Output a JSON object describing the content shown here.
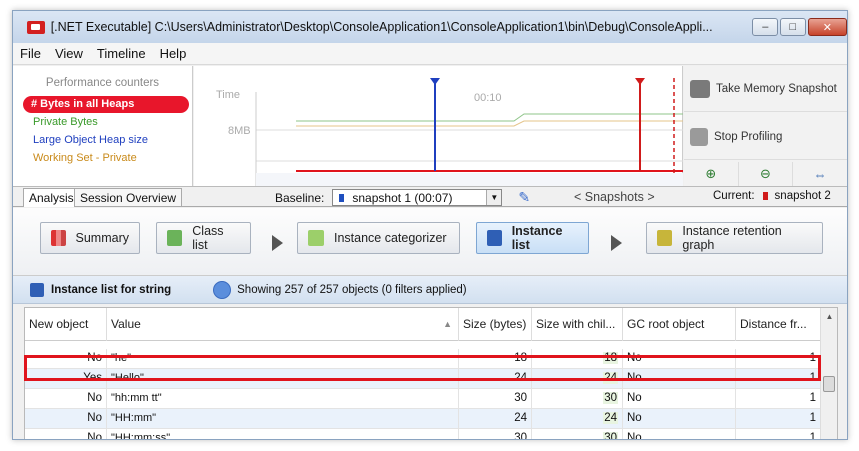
{
  "window": {
    "title": "[.NET Executable] C:\\Users\\Administrator\\Desktop\\ConsoleApplication1\\ConsoleApplication1\\bin\\Debug\\ConsoleAppli...",
    "minimize": "–",
    "maximize": "□",
    "close": "✕"
  },
  "menu": [
    "File",
    "View",
    "Timeline",
    "Help"
  ],
  "counters": {
    "title": "Performance counters",
    "items": [
      {
        "label": "# Bytes in all Heaps",
        "color": "#ffffff"
      },
      {
        "label": "Private Bytes",
        "color": "#3a9a2a"
      },
      {
        "label": "Large Object Heap size",
        "color": "#1f3fbf"
      },
      {
        "label": "Working Set - Private",
        "color": "#c98a1a"
      }
    ]
  },
  "timeline": {
    "time_label": "Time",
    "tick_label": "00:10",
    "mem_label": "8MB"
  },
  "snapshot_panel": {
    "take_snapshot": "Take Memory Snapshot",
    "stop_profiling": "Stop Profiling"
  },
  "tabs": {
    "analysis": "Analysis",
    "session_overview": "Session Overview"
  },
  "baseline": {
    "label": "Baseline:",
    "value": "snapshot 1 (00:07)"
  },
  "snapshots_nav": "< Snapshots >",
  "current": {
    "label": "Current:",
    "value": "snapshot 2"
  },
  "nav": {
    "summary": "Summary",
    "class_list": "Class list",
    "instance_categorizer": "Instance categorizer",
    "instance_list": "Instance list",
    "instance_retention_graph": "Instance retention graph"
  },
  "list_header": {
    "title": "Instance list for string",
    "status": "Showing 257 of 257 objects (0 filters applied)"
  },
  "grid": {
    "columns": [
      "New object",
      "Value",
      "Size (bytes)",
      "Size with chil...",
      "GC root object",
      "Distance fr..."
    ],
    "rows": [
      {
        "new_object": "No",
        "value": "\"he\"",
        "size": "18",
        "size_children": "18",
        "gc_root": "No",
        "distance": "1"
      },
      {
        "new_object": "Yes",
        "value": "\"Hello\"",
        "size": "24",
        "size_children": "24",
        "gc_root": "No",
        "distance": "1"
      },
      {
        "new_object": "No",
        "value": "\"hh:mm tt\"",
        "size": "30",
        "size_children": "30",
        "gc_root": "No",
        "distance": "1"
      },
      {
        "new_object": "No",
        "value": "\"HH:mm\"",
        "size": "24",
        "size_children": "24",
        "gc_root": "No",
        "distance": "1"
      },
      {
        "new_object": "No",
        "value": "\"HH:mm:ss\"",
        "size": "30",
        "size_children": "30",
        "gc_root": "No",
        "distance": "1"
      }
    ]
  },
  "colors": {
    "accent_red": "#e0141c",
    "selected_counter": "#e8162b",
    "baseline_marker": "#1f4fbf",
    "current_marker": "#d01b1b"
  }
}
